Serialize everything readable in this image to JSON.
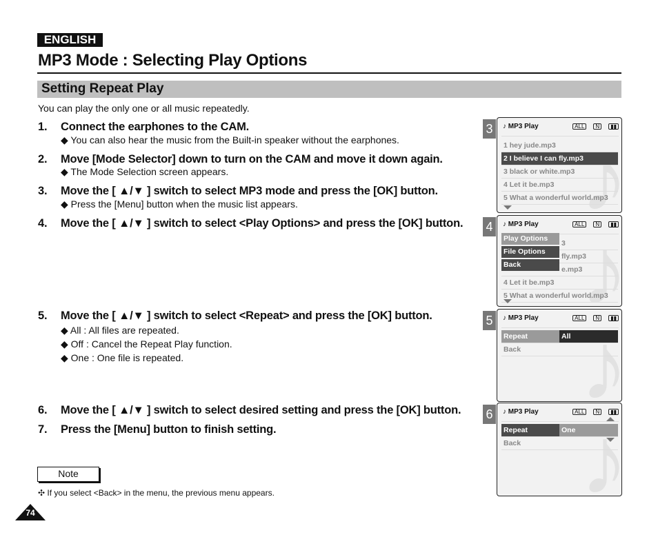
{
  "language_tab": "ENGLISH",
  "title": "MP3 Mode : Selecting Play Options",
  "section": "Setting Repeat Play",
  "intro": "You can play the only one or all music repeatedly.",
  "steps": [
    {
      "num": "1.",
      "text": "Connect the earphones to the CAM.",
      "subs": [
        "◆ You can also hear the music from the Built-in speaker without the earphones."
      ]
    },
    {
      "num": "2.",
      "text": "Move [Mode Selector] down to turn on the CAM and move it down again.",
      "subs": [
        "◆ The Mode Selection screen appears."
      ]
    },
    {
      "num": "3.",
      "text": "Move the [ ▲/▼ ] switch to select MP3 mode and press the [OK] button.",
      "subs": [
        "◆ Press the [Menu] button when the music list appears."
      ]
    },
    {
      "num": "4.",
      "text": "Move the [ ▲/▼ ] switch to select <Play Options> and press the [OK] button.",
      "subs": []
    },
    {
      "num": "5.",
      "text": "Move the [ ▲/▼ ] switch to select <Repeat> and press the [OK] button.",
      "subs": [
        "◆ All : All files are repeated.",
        "◆ Off : Cancel the Repeat Play function.",
        "◆ One : One file is repeated."
      ]
    },
    {
      "num": "6.",
      "text": "Move the [ ▲/▼ ] switch to select desired setting and press the [OK] button.",
      "subs": []
    },
    {
      "num": "7.",
      "text": "Press the [Menu] button to finish setting.",
      "subs": []
    }
  ],
  "note_label": "Note",
  "note_text": "✣   If you select <Back> in the menu, the previous menu appears.",
  "page_number": "74",
  "screens": [
    {
      "badge": "3",
      "header": "♪ MP3 Play",
      "rows": [
        "1  hey jude.mp3",
        "2  I believe I can fly.mp3",
        "3  black or white.mp3",
        "4  Let it be.mp3",
        "5  What a wonderful world.mp3"
      ]
    },
    {
      "badge": "4",
      "header": "♪ MP3 Play",
      "rows": [
        "",
        "",
        "",
        "4  Let it be.mp3",
        "5  What a wonderful world.mp3"
      ],
      "partial": [
        "3",
        "fly.mp3",
        "e.mp3"
      ],
      "menu": [
        "Play Options",
        "File Options",
        "Back"
      ]
    },
    {
      "badge": "5",
      "header": "♪ MP3 Play",
      "rows": [
        "Repeat",
        "Back"
      ],
      "value": "All"
    },
    {
      "badge": "6",
      "header": "♪ MP3 Play",
      "rows": [
        "Repeat",
        "Back"
      ],
      "value": "One"
    }
  ],
  "status_icons": [
    "ALL",
    "N",
    "battery"
  ]
}
